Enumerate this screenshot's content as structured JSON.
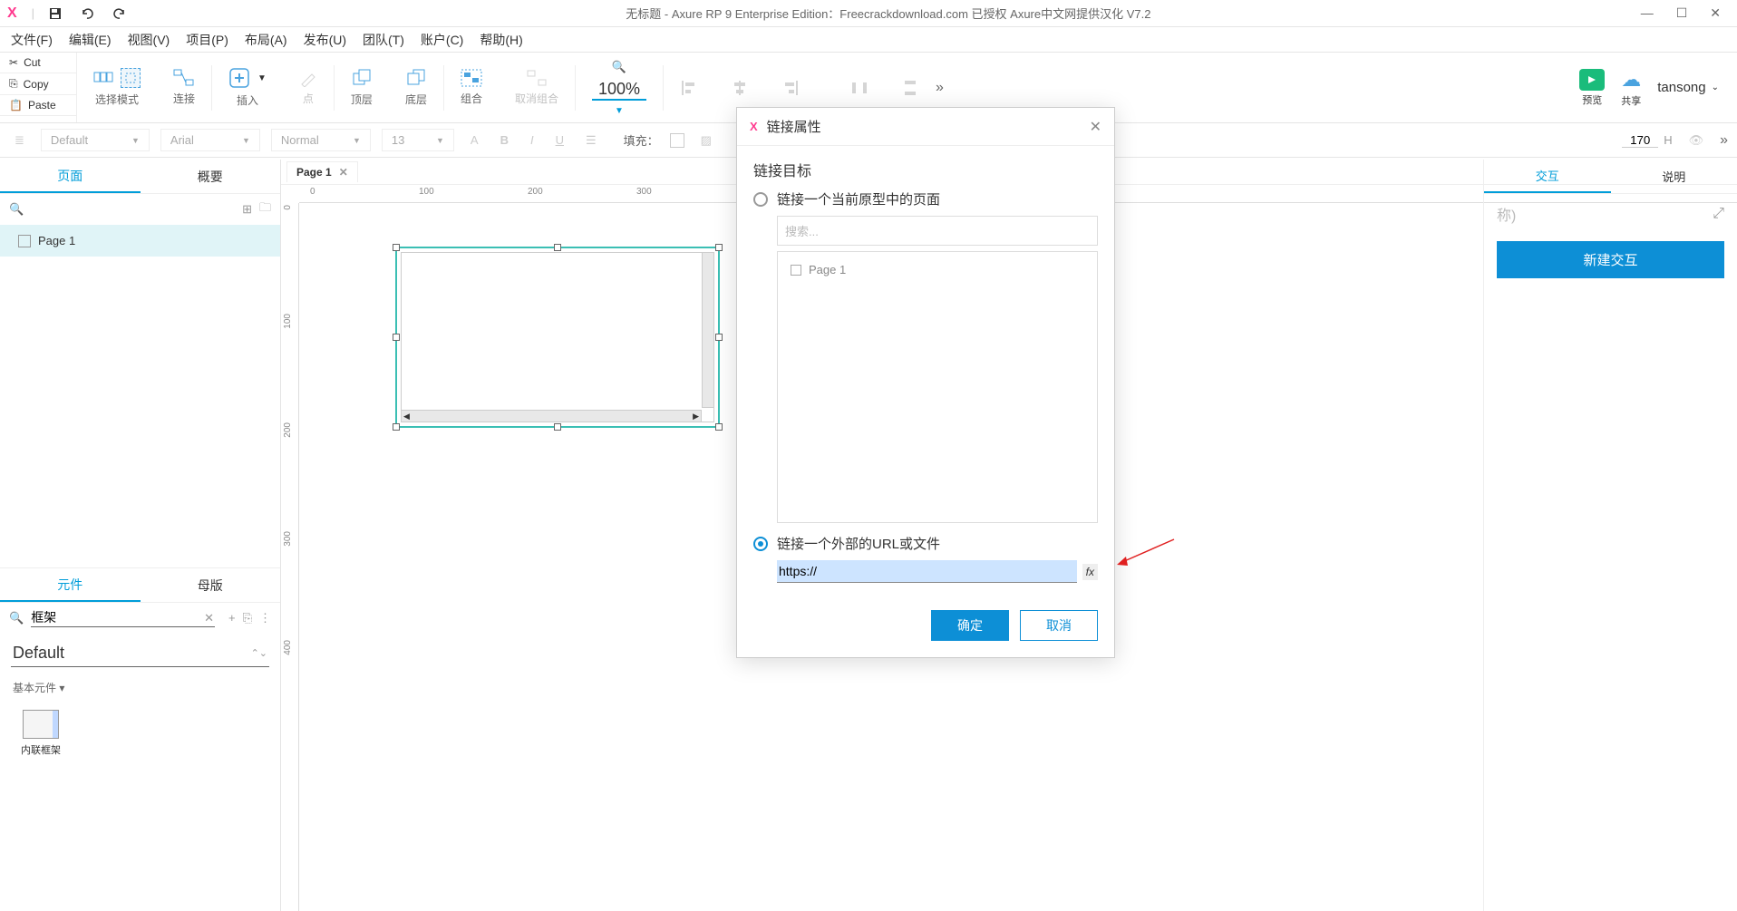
{
  "title": "无标题 - Axure RP 9 Enterprise Edition：Freecrackdownload.com 已授权   Axure中文网提供汉化 V7.2",
  "clip": {
    "cut": "Cut",
    "copy": "Copy",
    "paste": "Paste"
  },
  "menu": {
    "file": "文件(F)",
    "edit": "编辑(E)",
    "view": "视图(V)",
    "project": "项目(P)",
    "layout": "布局(A)",
    "publish": "发布(U)",
    "team": "团队(T)",
    "account": "账户(C)",
    "help": "帮助(H)"
  },
  "toolbar": {
    "select_mode": "选择模式",
    "connect": "连接",
    "insert": "插入",
    "point": "点",
    "front": "顶层",
    "back": "底层",
    "group": "组合",
    "ungroup": "取消组合",
    "zoom": "100%",
    "preview": "预览",
    "share": "共享",
    "user": "tansong"
  },
  "format": {
    "style": "Default",
    "font": "Arial",
    "weight": "Normal",
    "size": "13",
    "fill": "填充：",
    "height": "170",
    "h_label": "H"
  },
  "left": {
    "tab_pages": "页面",
    "tab_outline": "概要",
    "page1": "Page 1",
    "tab_widgets": "元件",
    "tab_masters": "母版",
    "widget_search": "框架",
    "default_lib": "Default",
    "basic_group": "基本元件 ▾",
    "iframe_widget": "内联框架"
  },
  "canvas": {
    "tab": "Page 1",
    "ruler_h": [
      "0",
      "100",
      "200",
      "300"
    ],
    "ruler_v": [
      "0",
      "100",
      "200",
      "300",
      "400"
    ]
  },
  "right": {
    "tab_interaction": "交互",
    "tab_notes": "说明",
    "name_placeholder": "称)",
    "new_interaction": "新建交互"
  },
  "dialog": {
    "title": "链接属性",
    "target_label": "链接目标",
    "opt_page": "链接一个当前原型中的页面",
    "search_placeholder": "搜索...",
    "page_item": "Page 1",
    "opt_url": "链接一个外部的URL或文件",
    "url_value": "https://",
    "fx": "fx",
    "ok": "确定",
    "cancel": "取消"
  }
}
